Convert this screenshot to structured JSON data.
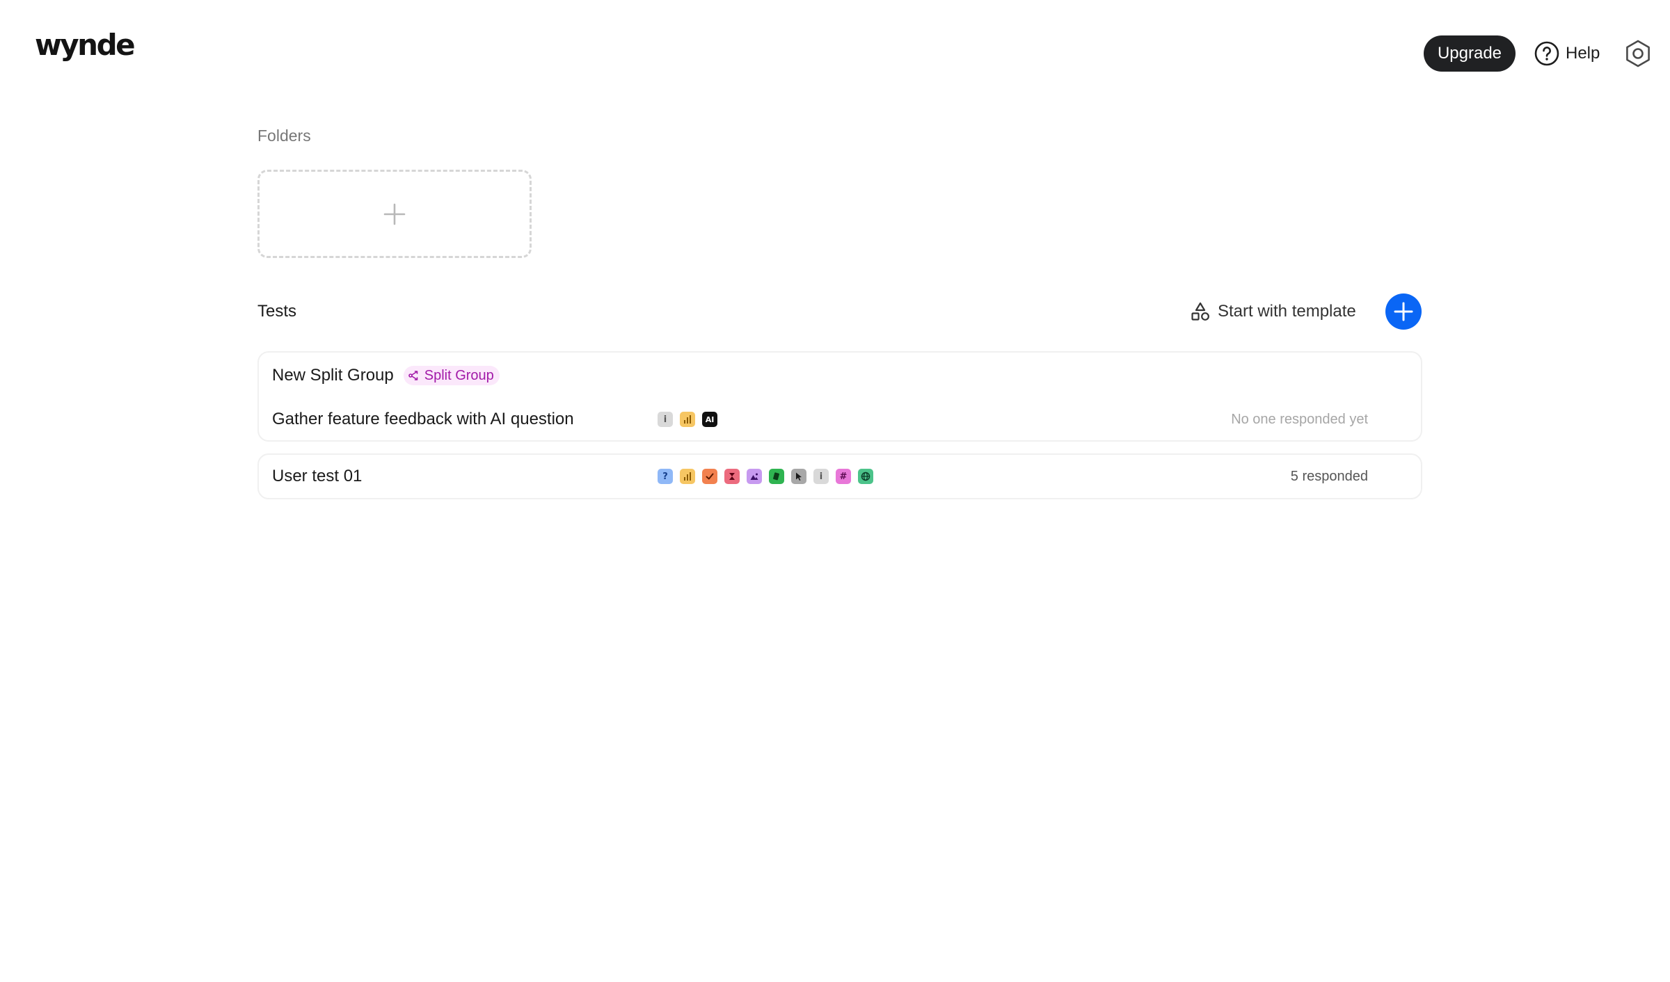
{
  "header": {
    "logo": "wynde",
    "upgrade_label": "Upgrade",
    "help_label": "Help"
  },
  "folders": {
    "label": "Folders"
  },
  "tests": {
    "title": "Tests",
    "template_label": "Start with template",
    "items": [
      {
        "group_name": "New Split Group",
        "badge_label": "Split Group",
        "test_name": "Gather feature feedback with AI question",
        "status": "No one responded yet",
        "icons": [
          "info-icon",
          "bar-chart-icon",
          "ai-icon"
        ]
      },
      {
        "test_name": "User test 01",
        "status": "5 responded",
        "icons": [
          "question-icon",
          "bar-chart-icon",
          "checkmark-icon",
          "hourglass-icon",
          "image-icon",
          "card-sort-icon",
          "cursor-icon",
          "info-icon",
          "hashtag-icon",
          "globe-icon"
        ]
      }
    ]
  },
  "colors": {
    "accent": "#0a66f5",
    "upgrade_bg": "#202123",
    "badge_bg": "#fbe8fb",
    "badge_text": "#a21aa8"
  }
}
